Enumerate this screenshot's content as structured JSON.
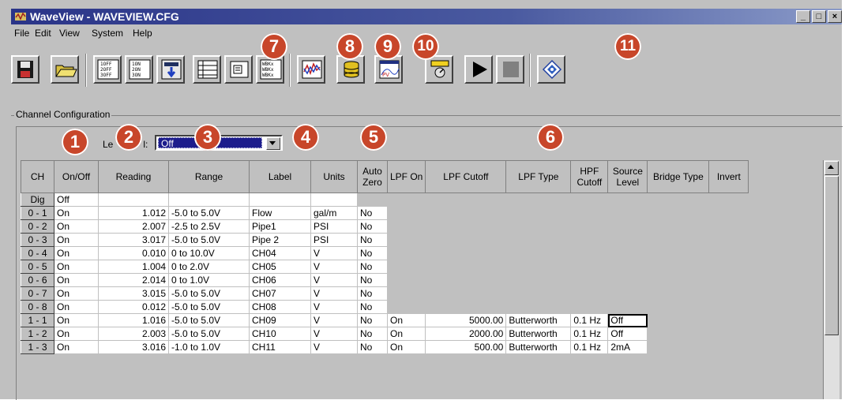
{
  "window": {
    "title": "WaveView - WAVEVIEW.CFG",
    "controls": [
      "_",
      "□",
      "×"
    ]
  },
  "menu": [
    {
      "label": "File"
    },
    {
      "label": "Edit"
    },
    {
      "label": "View"
    },
    {
      "label": "System"
    },
    {
      "label": "Help"
    }
  ],
  "toolbar": {
    "icons": [
      "save-icon",
      "open-folder-icon",
      "all-channels-off-icon",
      "all-channels-on-icon",
      "readings-icon",
      "notes-icon",
      "wbk-modules-icon",
      "analysis-icon",
      "database-icon",
      "pv-chart-icon",
      "meter-icon",
      "play-icon",
      "stop-icon",
      "diamond-target-icon"
    ],
    "badges": [
      "7",
      "8",
      "9",
      "10",
      "11"
    ]
  },
  "config": {
    "group_title": "Channel Configuration",
    "level_label": "Le",
    "level_suffix": "l:",
    "combo_value": "Off",
    "badges": [
      "1",
      "2",
      "3",
      "4",
      "5",
      "6"
    ]
  },
  "columns": [
    "CH",
    "On/Off",
    "Reading",
    "Range",
    "Label",
    "Units",
    "Auto Zero",
    "LPF On",
    "LPF Cutoff",
    "LPF Type",
    "HPF Cutoff",
    "Source Level",
    "Bridge Type",
    "Invert"
  ],
  "rows": [
    {
      "ch": "Dig",
      "onoff": "Off",
      "reading": "",
      "range": "",
      "label": "",
      "units": "",
      "autozero": "",
      "lpfon": "",
      "lpfcutoff": "",
      "lpftype": "",
      "hpf": "",
      "source": ""
    },
    {
      "ch": "0 - 1",
      "onoff": "On",
      "reading": "1.012",
      "range": "-5.0 to 5.0V",
      "label": "Flow",
      "units": "gal/m",
      "autozero": "No",
      "lpfon": "",
      "lpfcutoff": "",
      "lpftype": "",
      "hpf": "",
      "source": ""
    },
    {
      "ch": "0 - 2",
      "onoff": "On",
      "reading": "2.007",
      "range": "-2.5 to 2.5V",
      "label": "Pipe1",
      "units": "PSI",
      "autozero": "No",
      "lpfon": "",
      "lpfcutoff": "",
      "lpftype": "",
      "hpf": "",
      "source": ""
    },
    {
      "ch": "0 - 3",
      "onoff": "On",
      "reading": "3.017",
      "range": "-5.0 to 5.0V",
      "label": "Pipe 2",
      "units": "PSI",
      "autozero": "No",
      "lpfon": "",
      "lpfcutoff": "",
      "lpftype": "",
      "hpf": "",
      "source": ""
    },
    {
      "ch": "0 - 4",
      "onoff": "On",
      "reading": "0.010",
      "range": "0 to 10.0V",
      "label": "CH04",
      "units": "V",
      "autozero": "No",
      "lpfon": "",
      "lpfcutoff": "",
      "lpftype": "",
      "hpf": "",
      "source": ""
    },
    {
      "ch": "0 - 5",
      "onoff": "On",
      "reading": "1.004",
      "range": "0 to 2.0V",
      "label": "CH05",
      "units": "V",
      "autozero": "No",
      "lpfon": "",
      "lpfcutoff": "",
      "lpftype": "",
      "hpf": "",
      "source": ""
    },
    {
      "ch": "0 - 6",
      "onoff": "On",
      "reading": "2.014",
      "range": "0 to 1.0V",
      "label": "CH06",
      "units": "V",
      "autozero": "No",
      "lpfon": "",
      "lpfcutoff": "",
      "lpftype": "",
      "hpf": "",
      "source": ""
    },
    {
      "ch": "0 - 7",
      "onoff": "On",
      "reading": "3.015",
      "range": "-5.0 to 5.0V",
      "label": "CH07",
      "units": "V",
      "autozero": "No",
      "lpfon": "",
      "lpfcutoff": "",
      "lpftype": "",
      "hpf": "",
      "source": ""
    },
    {
      "ch": "0 - 8",
      "onoff": "On",
      "reading": "0.012",
      "range": "-5.0 to 5.0V",
      "label": "CH08",
      "units": "V",
      "autozero": "No",
      "lpfon": "",
      "lpfcutoff": "",
      "lpftype": "",
      "hpf": "",
      "source": ""
    },
    {
      "ch": "1 - 1",
      "onoff": "On",
      "reading": "1.016",
      "range": "-5.0 to 5.0V",
      "label": "CH09",
      "units": "V",
      "autozero": "No",
      "lpfon": "On",
      "lpfcutoff": "5000.00",
      "lpftype": "Butterworth",
      "hpf": "0.1 Hz",
      "source": "Off"
    },
    {
      "ch": "1 - 2",
      "onoff": "On",
      "reading": "2.003",
      "range": "-5.0 to 5.0V",
      "label": "CH10",
      "units": "V",
      "autozero": "No",
      "lpfon": "On",
      "lpfcutoff": "2000.00",
      "lpftype": "Butterworth",
      "hpf": "0.1 Hz",
      "source": "Off"
    },
    {
      "ch": "1 - 3",
      "onoff": "On",
      "reading": "3.016",
      "range": "-1.0 to 1.0V",
      "label": "CH11",
      "units": "V",
      "autozero": "No",
      "lpfon": "On",
      "lpfcutoff": "500.00",
      "lpftype": "Butterworth",
      "hpf": "0.1 Hz",
      "source": "2mA"
    }
  ],
  "colors": {
    "title_bar": "#2a3488",
    "badge": "#c8462a",
    "selection": "#1c1c8c",
    "chrome": "#c0c0c0"
  }
}
